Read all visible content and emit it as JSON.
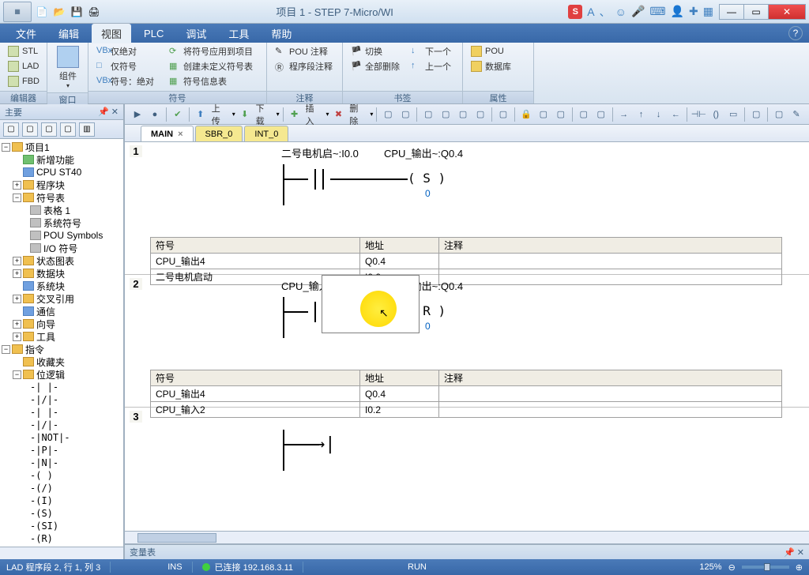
{
  "titlebar": {
    "title": "项目 1 - STEP 7-Micro/WI"
  },
  "menu": {
    "file": "文件",
    "edit": "编辑",
    "view": "视图",
    "plc": "PLC",
    "debug": "调试",
    "tools": "工具",
    "help": "帮助"
  },
  "ribbon": {
    "editor_group": "编辑器",
    "stl": "STL",
    "lad": "LAD",
    "fbd": "FBD",
    "window_group": "窗口",
    "component": "组件",
    "symbol_group": "符号",
    "abs_only": "仅绝对",
    "sym_only": "仅符号",
    "sym_abs": "符号：绝对",
    "apply_all": "将符号应用到项目",
    "create_undef": "创建未定义符号表",
    "sym_info": "符号信息表",
    "comment_group": "注释",
    "pou_comment": "POU 注释",
    "net_comment": "程序段注释",
    "bookmark_group": "书签",
    "switch": "切换",
    "del_all": "全部删除",
    "next": "下一个",
    "prev": "上一个",
    "prop_group": "属性",
    "pou": "POU",
    "datablock": "数据库"
  },
  "toolbar": {
    "upload": "上传",
    "download": "下载",
    "insert": "插入",
    "delete": "删除"
  },
  "left_panel": {
    "title": "主要"
  },
  "tree": {
    "project": "项目1",
    "new_feature": "新增功能",
    "cpu": "CPU ST40",
    "program_block": "程序块",
    "symbol_table": "符号表",
    "table1": "表格 1",
    "sys_symbols": "系统符号",
    "pou_symbols": "POU Symbols",
    "io_symbols": "I/O 符号",
    "status_chart": "状态图表",
    "data_block": "数据块",
    "sys_block": "系统块",
    "cross_ref": "交叉引用",
    "comm": "通信",
    "wizards": "向导",
    "tools": "工具",
    "instructions": "指令",
    "favorites": "收藏夹",
    "bit_logic": "位逻辑",
    "c1": "-| |-",
    "c2": "-|/|-",
    "c3": "-| |-",
    "c4": "-|/|-",
    "c5": "-|NOT|-",
    "c6": "-|P|-",
    "c7": "-|N|-",
    "c8": "-( )",
    "c9": "-(/)",
    "c10": "-(I)",
    "c11": "-(S)",
    "c12": "-(SI)",
    "c13": "-(R)"
  },
  "tabs": {
    "main": "MAIN",
    "sbr": "SBR_0",
    "int": "INT_0"
  },
  "network1": {
    "num": "1",
    "label1": "二号电机启~:I0.0",
    "label2": "CPU_输出~:Q0.4",
    "coil": "( S )",
    "val": "0",
    "table": {
      "h_symbol": "符号",
      "h_addr": "地址",
      "h_comment": "注释",
      "r1_sym": "CPU_输出4",
      "r1_addr": "Q0.4",
      "r2_sym": "二号电机启动",
      "r2_addr": "I0.0"
    }
  },
  "network2": {
    "num": "2",
    "label1": "CPU_输入2:I0.2",
    "label2": "CPU_输出~:Q0.4",
    "coil": "( R )",
    "val": "0",
    "table": {
      "h_symbol": "符号",
      "h_addr": "地址",
      "h_comment": "注释",
      "r1_sym": "CPU_输出4",
      "r1_addr": "Q0.4",
      "r2_sym": "CPU_输入2",
      "r2_addr": "I0.2"
    }
  },
  "network3": {
    "num": "3"
  },
  "var_panel": {
    "title": "变量表"
  },
  "status": {
    "pos": "LAD 程序段 2, 行 1, 列 3",
    "ins": "INS",
    "conn": "已连接 192.168.3.11",
    "run": "RUN",
    "zoom": "125%"
  }
}
